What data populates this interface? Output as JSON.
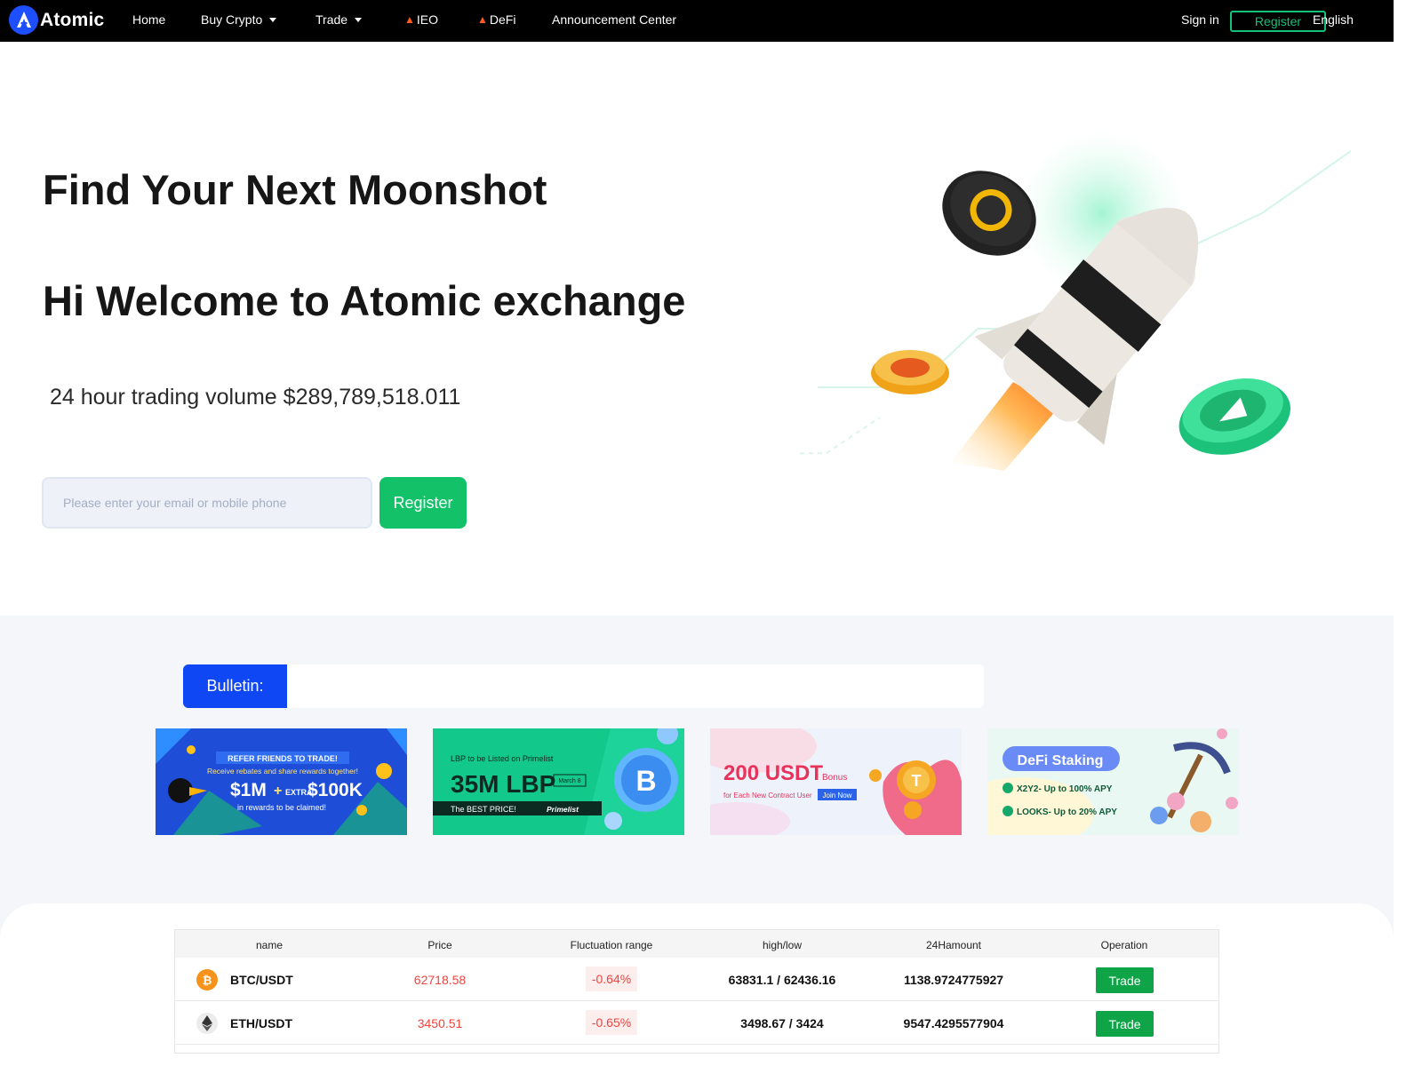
{
  "brand": {
    "name": "Atomic",
    "accent": "#12c168",
    "primary_blue": "#0f47f5"
  },
  "nav": {
    "home": "Home",
    "buy_crypto": "Buy Crypto",
    "trade": "Trade",
    "ieo": "IEO",
    "defi": "DeFi",
    "announcement": "Announcement Center",
    "sign_in": "Sign in",
    "register": "Register",
    "language": "English"
  },
  "hero": {
    "title": "Find Your Next Moonshot",
    "welcome": "Hi Welcome to Atomic exchange",
    "volume": "24 hour trading volume $289,789,518.011",
    "email_placeholder": "Please enter your email or mobile phone",
    "register_button": "Register"
  },
  "bulletin": {
    "label": "Bulletin:"
  },
  "banners": [
    {
      "line1": "REFER FRIENDS TO TRADE!",
      "line2": "Receive rebates and share rewards together!",
      "amount": "$1M",
      "plus": "+",
      "extra_label": "EXTRA",
      "extra": "$100K",
      "line3": "in rewards to be claimed!"
    },
    {
      "line1": "LBP to be Listed on Primelist",
      "amount": "35M LBP",
      "date": "March 8",
      "tagline": "The BEST PRICE!",
      "brand": "Primelist"
    },
    {
      "amount": "200 USDT",
      "bonus": "Bonus",
      "sub": "for Each New Contract User",
      "cta": "Join Now"
    },
    {
      "title": "DeFi Staking",
      "item1": "X2Y2- Up to 100% APY",
      "item2": "LOOKS- Up to 20% APY"
    }
  ],
  "market": {
    "headers": [
      "name",
      "Price",
      "Fluctuation range",
      "high/low",
      "24Hamount",
      "Operation"
    ],
    "rows": [
      {
        "pair": "BTC/USDT",
        "icon": "bitcoin-icon",
        "price": "62718.58",
        "change": "-0.64%",
        "high_low": "63831.1 / 62436.16",
        "amount": "1138.9724775927",
        "action": "Trade"
      },
      {
        "pair": "ETH/USDT",
        "icon": "ethereum-icon",
        "price": "3450.51",
        "change": "-0.65%",
        "high_low": "3498.67 / 3424",
        "amount": "9547.4295577904",
        "action": "Trade"
      }
    ]
  }
}
